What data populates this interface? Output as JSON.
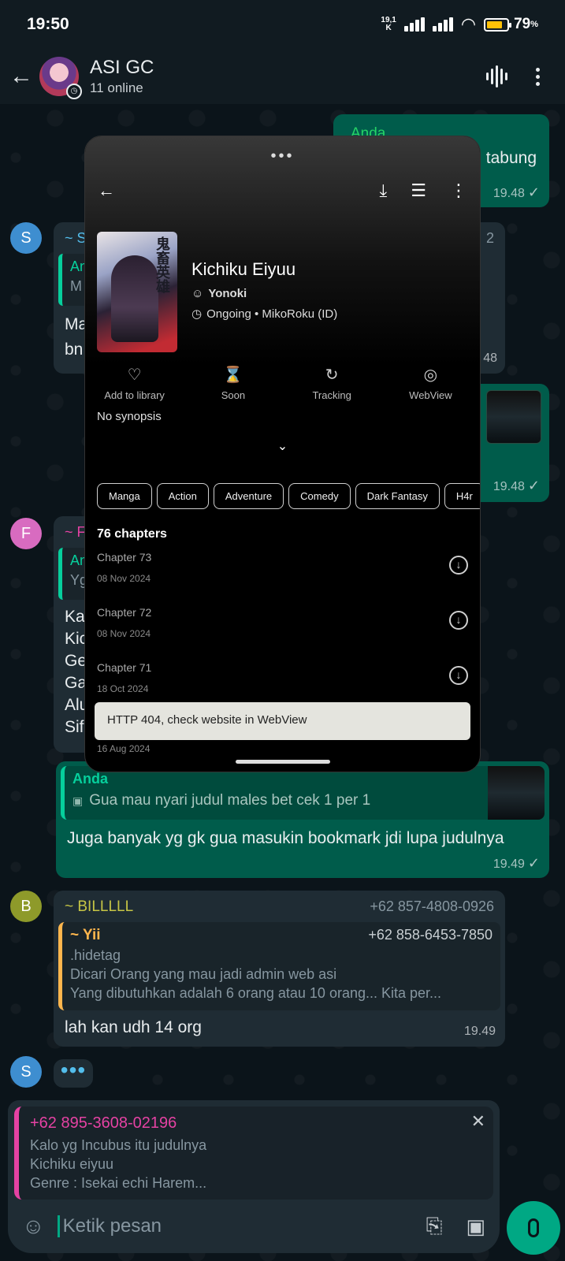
{
  "status_bar": {
    "time": "19:50",
    "net_speed_top": "19,1",
    "net_speed_unit": "K",
    "battery": "79",
    "battery_unit": "%"
  },
  "header": {
    "title": "ASI GC",
    "subtitle": "11 online"
  },
  "messages": {
    "m1_sender": "Anda",
    "m1_text": "n tabung",
    "m1_time": "19.48",
    "m2_avatar": "S",
    "m2_sender": "~ S",
    "m2_phone_tail": "2",
    "m2_reply_sender": "An",
    "m2_reply_text": "M",
    "m2_line1": "Ma",
    "m2_line2": "bn",
    "m2_time": "48",
    "m3_time": "19.48",
    "m4_avatar": "F",
    "m4_sender": "~ F",
    "m4_reply_sender": "An",
    "m4_reply_text": "Yg",
    "m4_lines": [
      "Ka",
      "Kic",
      "Ge",
      "Ga",
      "Alu",
      "Sif"
    ],
    "m5_reply_sender": "Anda",
    "m5_reply_text": "Gua mau nyari judul males bet cek 1 per 1",
    "m5_text": "Juga banyak yg gk gua masukin bookmark jdi lupa judulnya",
    "m5_time": "19.49",
    "m6_avatar": "B",
    "m6_sender": "~ BILLLLL",
    "m6_phone": "+62 857-4808-0926",
    "m6_reply_sender": "~ Yii",
    "m6_reply_phone": "+62 858-6453-7850",
    "m6_reply_line1": ".hidetag",
    "m6_reply_line2": "Dicari Orang yang mau jadi admin web asi",
    "m6_reply_line3": "Yang dibutuhkan adalah 6 orang atau 10 orang... Kita per...",
    "m6_text": "lah kan udh 14 org",
    "m6_time": "19.49",
    "typing_avatar": "S"
  },
  "overlay": {
    "title": "Kichiku Eiyuu",
    "author": "Yonoki",
    "status": "Ongoing • MikoRoku (ID)",
    "actions": [
      "Add to library",
      "Soon",
      "Tracking",
      "WebView"
    ],
    "synopsis": "No synopsis",
    "tags": [
      "Manga",
      "Action",
      "Adventure",
      "Comedy",
      "Dark Fantasy",
      "H4r"
    ],
    "chapters_count": "76 chapters",
    "chapters": [
      {
        "name": "Chapter 73",
        "date": "08 Nov 2024"
      },
      {
        "name": "Chapter 72",
        "date": "08 Nov 2024"
      },
      {
        "name": "Chapter 71",
        "date": "18 Oct 2024"
      }
    ],
    "ghost_date": "16 Aug 2024",
    "toast": "HTTP 404, check website in WebView"
  },
  "composer": {
    "reply_sender": "+62 895-3608-02196",
    "reply_line1": "Kalo yg Incubus itu judulnya",
    "reply_line2": "Kichiku eiyuu",
    "reply_line3": "Genre : Isekai echi Harem...",
    "placeholder": "Ketik pesan"
  },
  "colors": {
    "accent": "#00a884",
    "outgoing": "#005c4b",
    "incoming": "#1f2c34",
    "reply_pink": "#e542a3",
    "bill_yellow": "#c6c545",
    "yii_orange": "#ffb64d"
  }
}
